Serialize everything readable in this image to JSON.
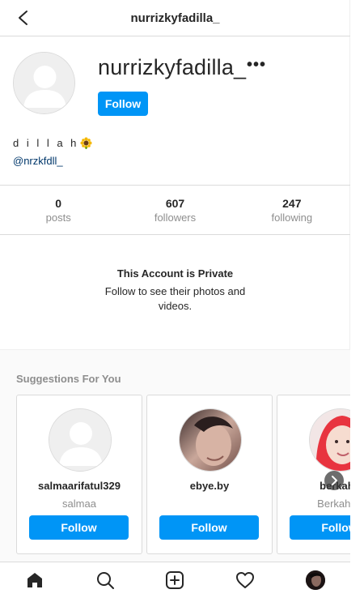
{
  "header": {
    "title": "nurrizkyfadilla_",
    "back_icon": "chevron-left-icon"
  },
  "profile": {
    "username": "nurrizkyfadilla_",
    "more_label": "•••",
    "follow_label": "Follow",
    "bio_name": "d i l l a h",
    "bio_emoji_icon": "sunflower-icon",
    "bio_link": "@nrzkfdll_"
  },
  "stats": [
    {
      "value": "0",
      "label": "posts"
    },
    {
      "value": "607",
      "label": "followers"
    },
    {
      "value": "247",
      "label": "following"
    }
  ],
  "private": {
    "title": "This Account is Private",
    "subtitle": "Follow to see their photos and videos."
  },
  "suggestions": {
    "title": "Suggestions For You",
    "cards": [
      {
        "username": "salmaarifatul329",
        "name": "salmaa",
        "follow_label": "Follow"
      },
      {
        "username": "ebye.by",
        "name": "",
        "follow_label": "Follow"
      },
      {
        "username": "berkahe",
        "name": "Berkah M",
        "follow_label": "Follow"
      }
    ],
    "next_icon": "chevron-right-icon"
  },
  "nav": {
    "items": [
      "home-icon",
      "search-icon",
      "new-post-icon",
      "heart-icon",
      "profile-avatar"
    ]
  },
  "colors": {
    "accent": "#0095f6",
    "text": "#262626",
    "muted": "#8e8e8e",
    "link": "#00376b",
    "border": "#dbdbdb"
  }
}
